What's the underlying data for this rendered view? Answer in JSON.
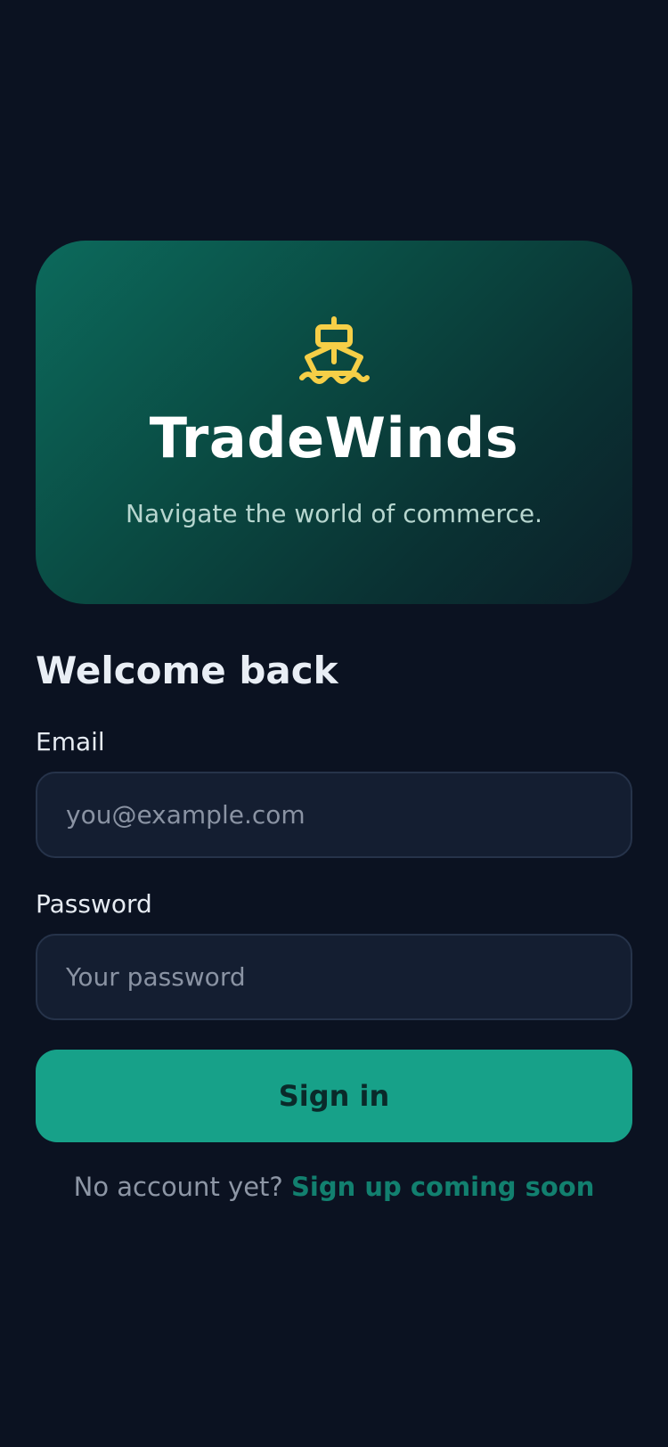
{
  "hero": {
    "logo_icon": "ship-icon",
    "logo_color": "#f6cf47",
    "brand": "TradeWinds",
    "tagline": "Navigate the world of commerce."
  },
  "login": {
    "heading": "Welcome back",
    "email_label": "Email",
    "email_placeholder": "you@example.com",
    "password_label": "Password",
    "password_placeholder": "Your password",
    "submit_label": "Sign in"
  },
  "footer": {
    "prompt": "No account yet?",
    "link_label": "Sign up coming soon"
  },
  "colors": {
    "background": "#0b1221",
    "accent": "#17a189",
    "link": "#12806f"
  }
}
